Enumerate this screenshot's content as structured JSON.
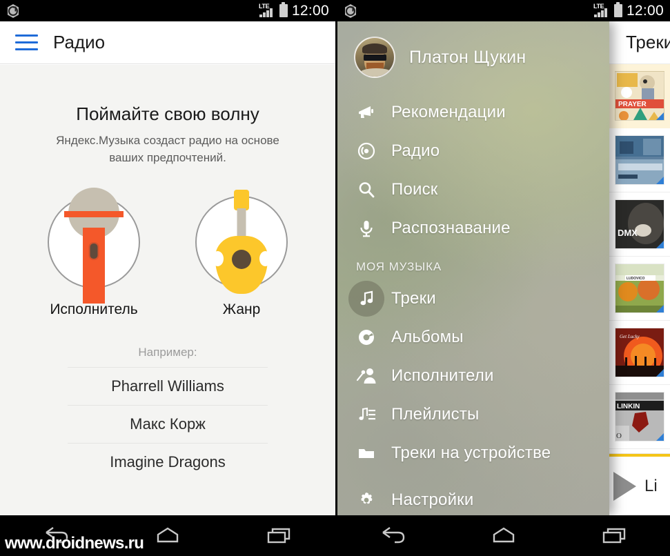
{
  "status_bar": {
    "app_icon": "yandex-music-logo-icon",
    "network_label": "LTE",
    "signal_icon": "signal-bars-icon",
    "battery_icon": "battery-full-icon",
    "clock": "12:00"
  },
  "nav_bar": {
    "back_label": "back-icon",
    "home_label": "home-icon",
    "recents_label": "recents-icon"
  },
  "left_screen": {
    "toolbar": {
      "menu_icon": "hamburger-menu-icon",
      "title": "Радио"
    },
    "heading": "Поймайте свою волну",
    "subheading": "Яндекс.Музыка создаст радио на основе ваших предпочтений.",
    "choices": [
      {
        "id": "artist",
        "label": "Исполнитель",
        "icon": "microphone-icon"
      },
      {
        "id": "genre",
        "label": "Жанр",
        "icon": "guitar-icon"
      }
    ],
    "examples_title": "Например:",
    "examples": [
      "Pharrell Williams",
      "Макс Корж",
      "Imagine Dragons"
    ]
  },
  "right_screen": {
    "tracks_panel": {
      "menu_icon": "hamburger-menu-icon",
      "title": "Треки",
      "rows": [
        {
          "id": "row-1",
          "cover": "prayer-in-c-cover",
          "playing": true
        },
        {
          "id": "row-2",
          "cover": "blue-photo-cover",
          "playing": false
        },
        {
          "id": "row-3",
          "cover": "dmx-cover",
          "playing": false
        },
        {
          "id": "row-4",
          "cover": "ludovico-einaudi-cover",
          "playing": false
        },
        {
          "id": "row-5",
          "cover": "get-lucky-cover",
          "playing": false
        },
        {
          "id": "row-6",
          "cover": "linkin-park-cover",
          "playing": false
        }
      ],
      "player": {
        "play_icon": "play-icon",
        "track_label": "Li",
        "progress_color": "#f5c518"
      }
    },
    "drawer": {
      "user_name": "Платон Щукин",
      "avatar_icon": "user-avatar",
      "items": [
        {
          "id": "recommendations",
          "label": "Рекомендации",
          "icon": "megaphone-icon",
          "selected": false
        },
        {
          "id": "radio",
          "label": "Радио",
          "icon": "radio-waves-icon",
          "selected": false
        },
        {
          "id": "search",
          "label": "Поиск",
          "icon": "search-icon",
          "selected": false
        },
        {
          "id": "recognition",
          "label": "Распознавание",
          "icon": "microphone-icon",
          "selected": false
        }
      ],
      "section_label": "МОЯ МУЗЫКА",
      "library_items": [
        {
          "id": "tracks",
          "label": "Треки",
          "icon": "music-note-icon",
          "selected": true
        },
        {
          "id": "albums",
          "label": "Альбомы",
          "icon": "disc-icon",
          "selected": false
        },
        {
          "id": "artists",
          "label": "Исполнители",
          "icon": "artist-mic-icon",
          "selected": false
        },
        {
          "id": "playlists",
          "label": "Плейлисты",
          "icon": "playlist-icon",
          "selected": false
        },
        {
          "id": "device_tracks",
          "label": "Треки на устройстве",
          "icon": "folder-icon",
          "selected": false
        }
      ],
      "settings": {
        "id": "settings",
        "label": "Настройки",
        "icon": "gear-icon",
        "selected": false
      }
    }
  },
  "watermark": "www.droidnews.ru",
  "colors": {
    "accent_blue": "#1f6bd8",
    "orange": "#f4582a",
    "yellow": "#fcc72b",
    "highlight_row": "#fdf3d8",
    "progress": "#f5c518"
  }
}
